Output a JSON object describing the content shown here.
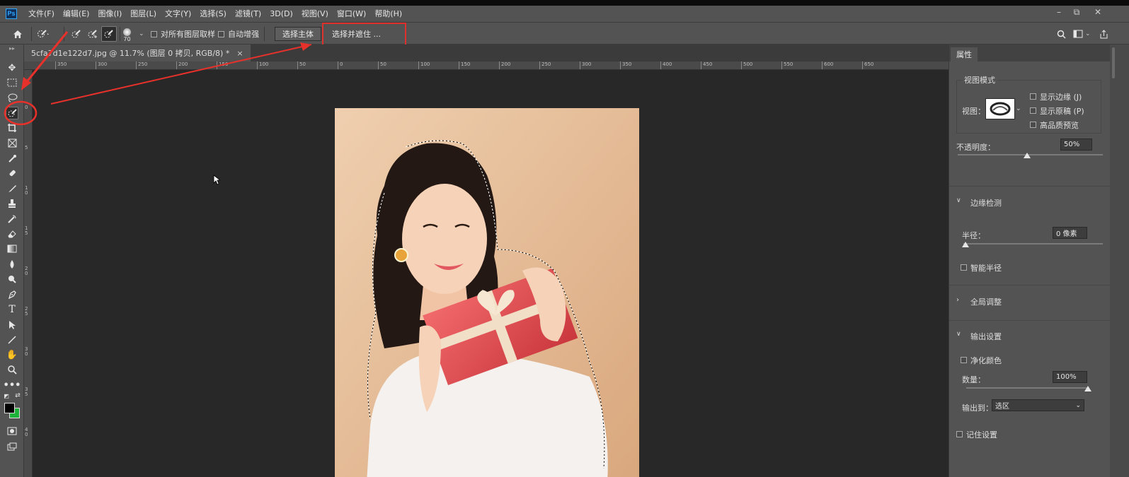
{
  "app": {
    "logo": "Ps"
  },
  "menu": [
    "文件(F)",
    "编辑(E)",
    "图像(I)",
    "图层(L)",
    "文字(Y)",
    "选择(S)",
    "滤镜(T)",
    "3D(D)",
    "视图(V)",
    "窗口(W)",
    "帮助(H)"
  ],
  "window_controls": {
    "minimize": "–",
    "restore": "⧉",
    "close": "✕"
  },
  "options": {
    "brush_size": "70",
    "sample_all_layers": "对所有图层取样",
    "auto_enhance": "自动增强",
    "select_subject": "选择主体",
    "select_and_mask": "选择并遮住 ..."
  },
  "document": {
    "tab_title": "5cfa7d1e122d7.jpg @ 11.7% (图层 0 拷贝, RGB/8) *",
    "close": "×"
  },
  "ruler_top_labels": [
    "350",
    "300",
    "250",
    "200",
    "150",
    "100",
    "50",
    "0",
    "50",
    "100",
    "150",
    "200",
    "250",
    "300",
    "350",
    "400",
    "450",
    "500",
    "550",
    "600",
    "650"
  ],
  "ruler_left_labels": [
    "0",
    "5",
    "1\n0",
    "1\n5",
    "2\n0",
    "2\n5",
    "3\n0",
    "3\n5",
    "4\n0"
  ],
  "properties": {
    "tab": "属性",
    "view_mode": {
      "heading": "视图模式",
      "view_label": "视图：",
      "show_edge": "显示边缘 (J)",
      "show_original": "显示原稿 (P)",
      "hq_preview": "高品质预览"
    },
    "opacity": {
      "label": "不透明度：",
      "value": "50%",
      "level": 0.5
    },
    "edge_detection": {
      "heading": "边缘检测",
      "radius_label": "半径：",
      "radius_value": "0 像素",
      "smart_radius": "智能半径"
    },
    "global_refinements": {
      "heading": "全局调整"
    },
    "output_settings": {
      "heading": "输出设置",
      "decontaminate": "净化颜色",
      "amount_label": "数量：",
      "amount_value": "100%",
      "amount_level": 1.0,
      "output_to_label": "输出到：",
      "output_to_value": "选区"
    },
    "remember": "记住设置"
  },
  "colors": {
    "annotation_red": "#e8312b",
    "photo_bg": "#e9c3a2",
    "gift_box": "#e8585c",
    "foreground_color": "#000000",
    "background_color": "#1db33a"
  }
}
